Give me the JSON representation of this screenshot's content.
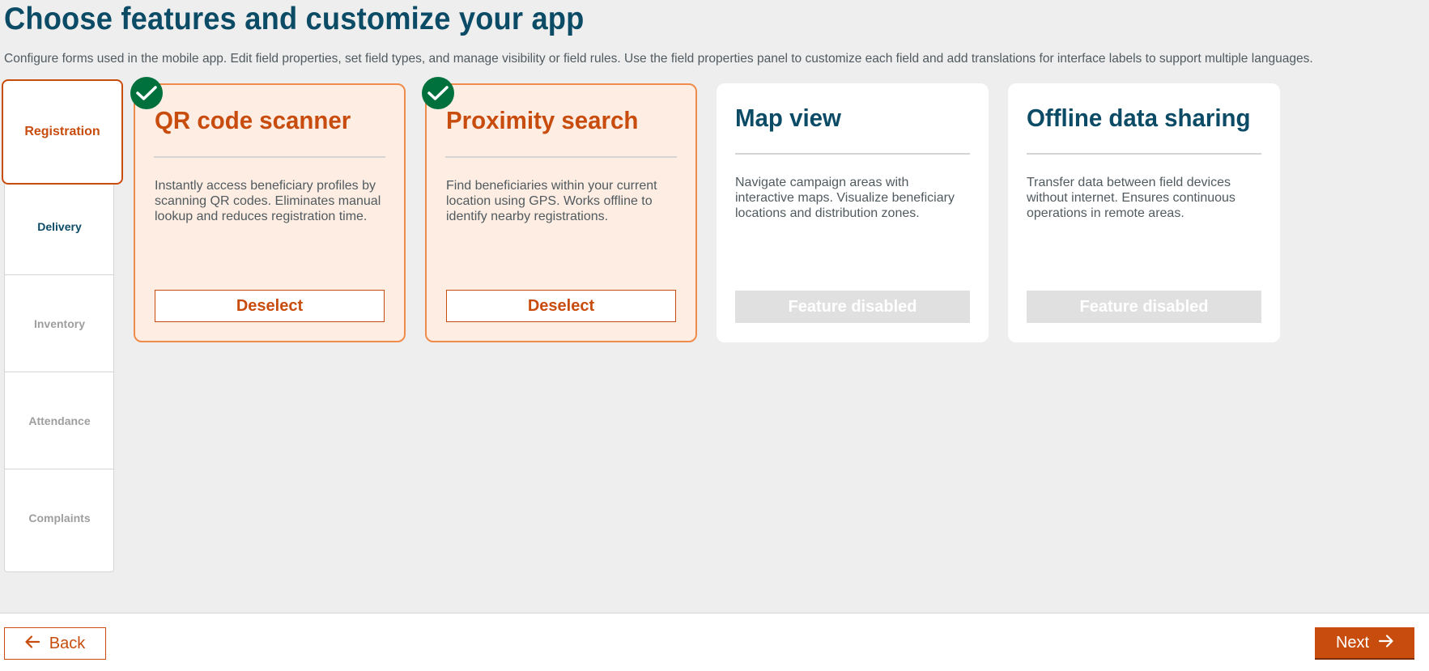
{
  "header": {
    "title": "Choose features and customize your app",
    "description": "Configure forms used in the mobile app. Edit field properties, set field types, and manage visibility or field rules. Use the field properties panel to customize each field and add translations for interface labels to support multiple languages."
  },
  "sidebar": {
    "items": [
      {
        "label": "Registration",
        "state": "selected"
      },
      {
        "label": "Delivery",
        "state": "enabled"
      },
      {
        "label": "Inventory",
        "state": "muted"
      },
      {
        "label": "Attendance",
        "state": "muted"
      },
      {
        "label": "Complaints",
        "state": "muted"
      }
    ]
  },
  "cards": [
    {
      "title": "QR code scanner",
      "description": "Instantly access beneficiary profiles by scanning QR codes. Eliminates manual lookup and reduces registration time.",
      "button": "Deselect",
      "selected": true
    },
    {
      "title": "Proximity search",
      "description": "Find beneficiaries within your current location using GPS. Works offline to identify nearby registrations.",
      "button": "Deselect",
      "selected": true
    },
    {
      "title": "Map view",
      "description": "Navigate campaign areas with interactive maps. Visualize beneficiary locations and distribution zones.",
      "button": "Feature disabled",
      "selected": false
    },
    {
      "title": "Offline data sharing",
      "description": "Transfer data between field devices without internet. Ensures continuous operations in remote areas.",
      "button": "Feature disabled",
      "selected": false
    }
  ],
  "footer": {
    "back_label": "Back",
    "next_label": "Next"
  },
  "colors": {
    "primary": "#c84c0e",
    "heading": "#0b4b66",
    "selected_bg": "#fdede2",
    "check": "#00703c",
    "disabled": "#e0e0e0"
  },
  "icons": {
    "back": "arrow-left-icon",
    "next": "arrow-right-icon",
    "selected": "check-circle-icon"
  }
}
